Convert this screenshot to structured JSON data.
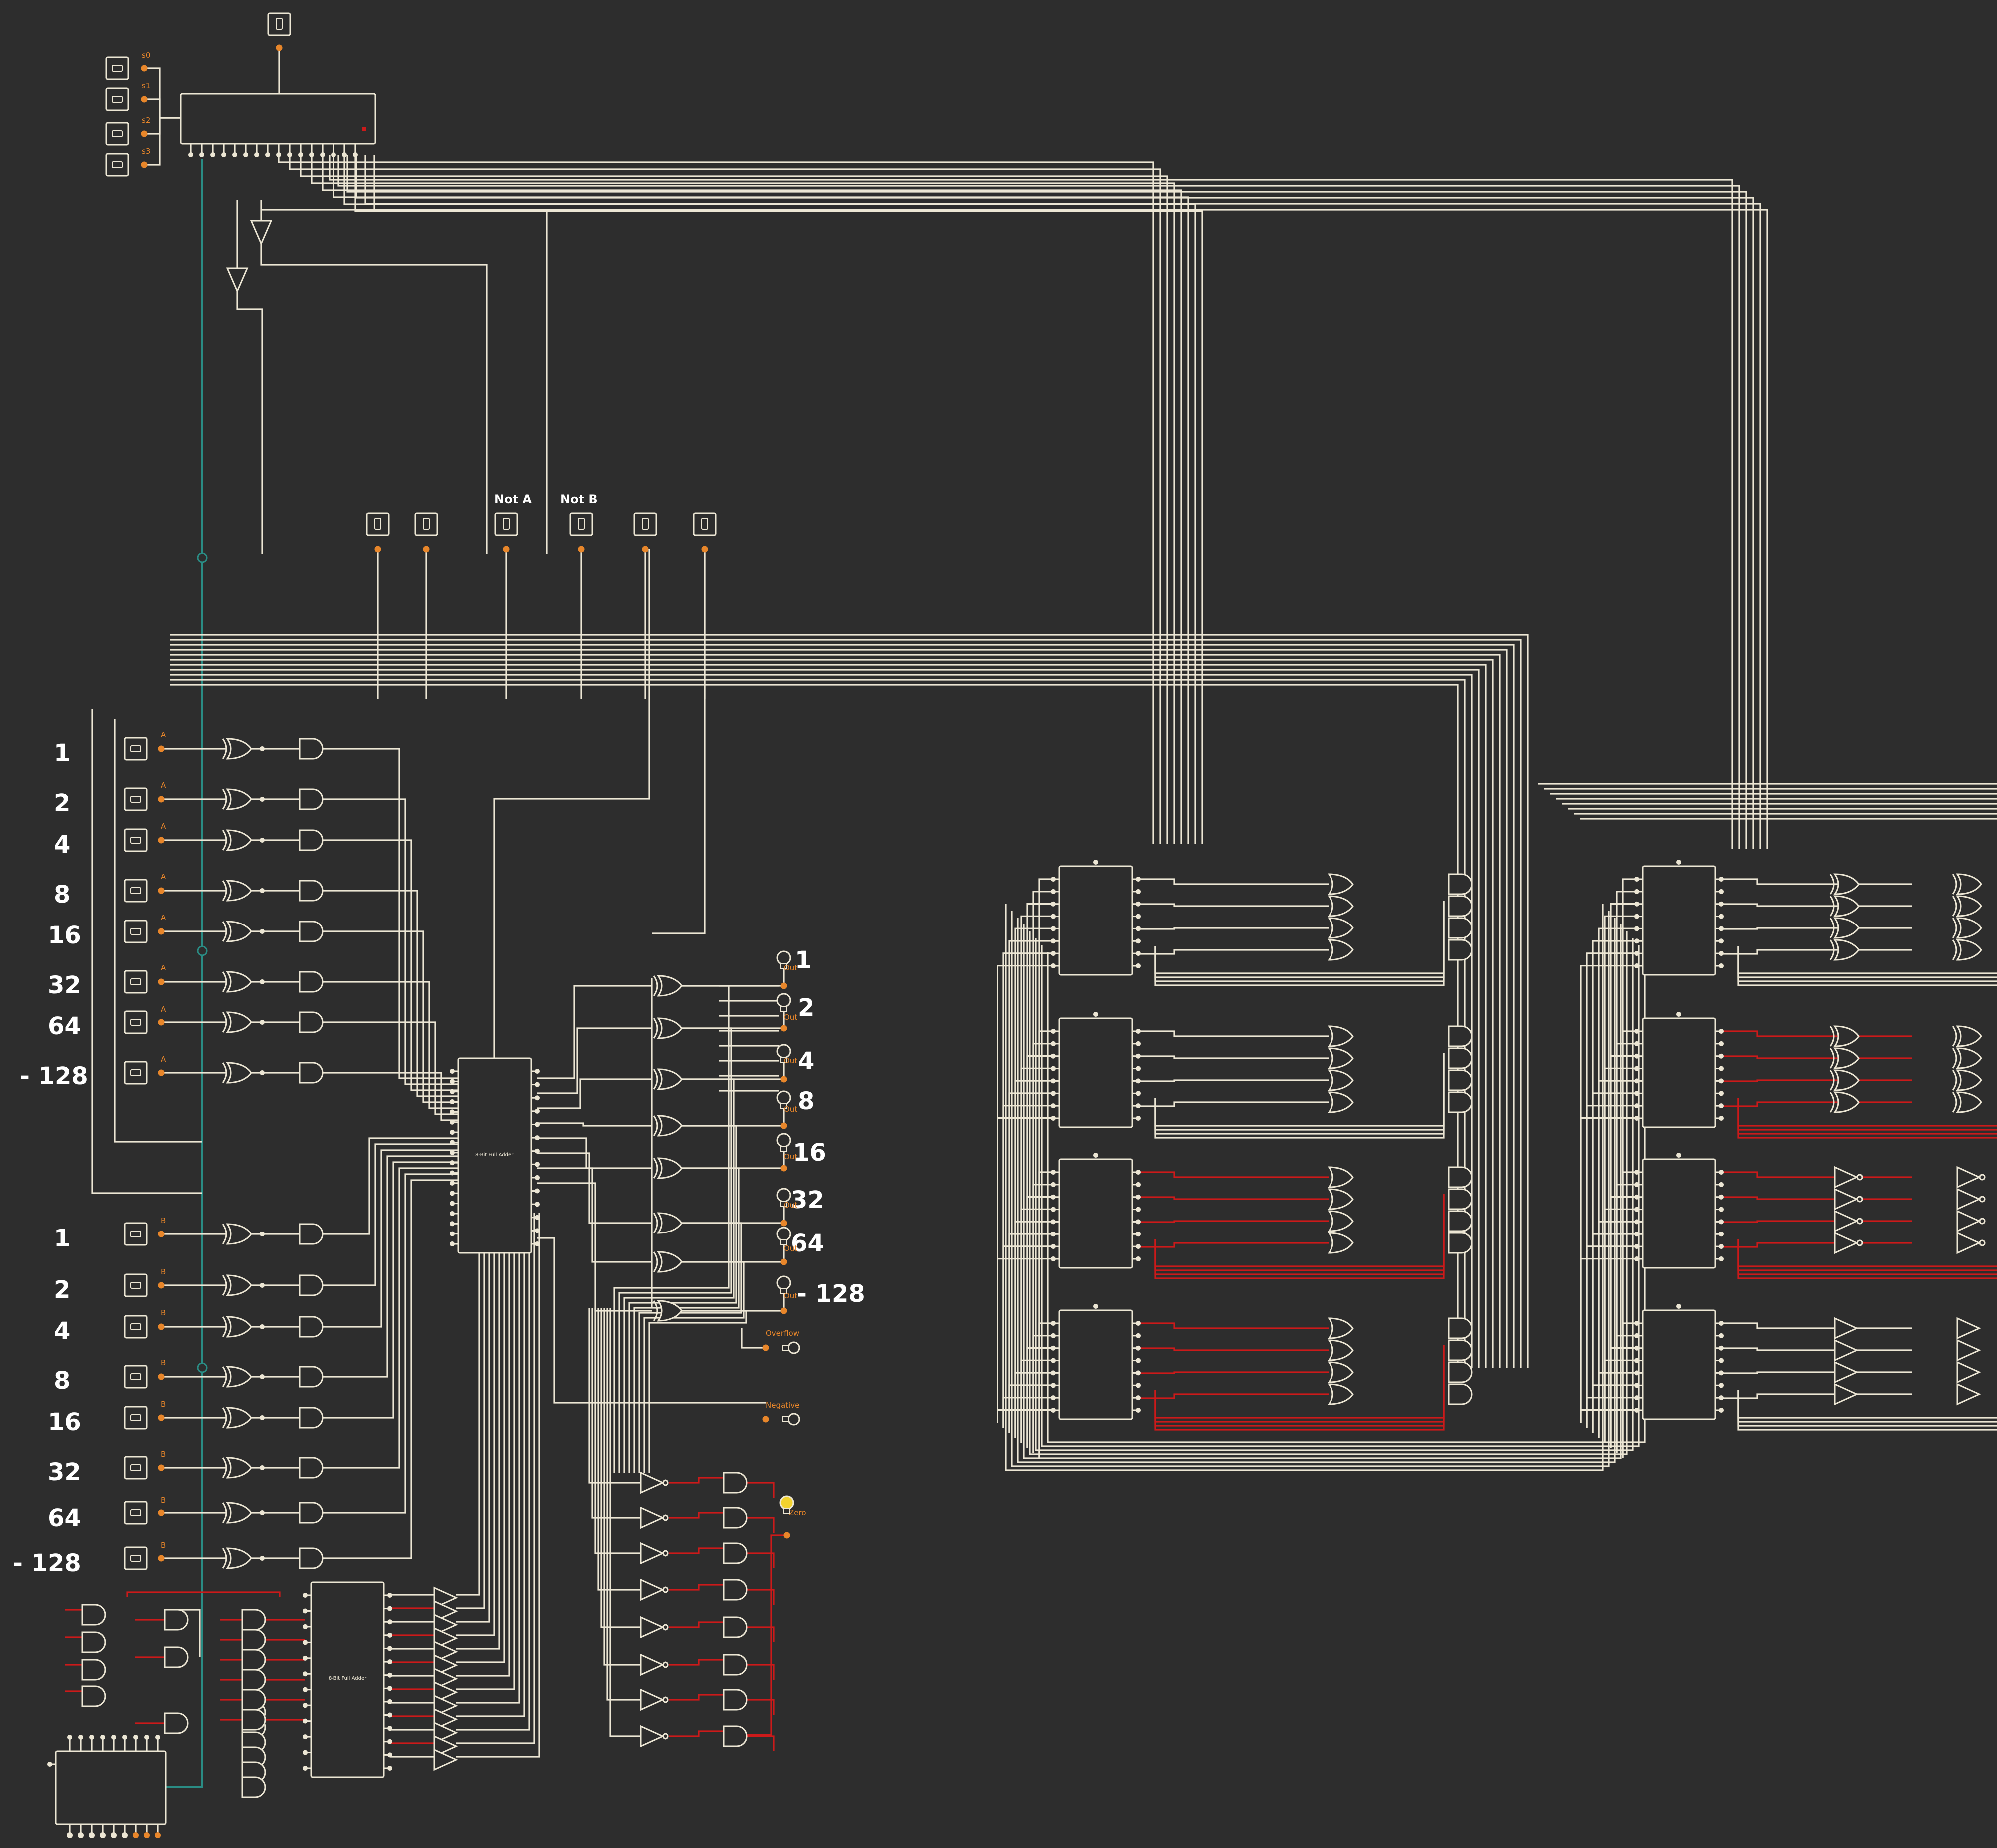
{
  "canvas": {
    "background": "#2d2d2d",
    "wire_color": "#ece6d4",
    "active_wire_color": "#cc1a1a",
    "bus_color": "#2a8c84",
    "pin_color": "#e8862a",
    "lamp_on_color": "#f2d22e"
  },
  "select_inputs": [
    "s0",
    "s1",
    "s2",
    "s3"
  ],
  "mode_switch_labels": [
    "Not A",
    "Not B"
  ],
  "input_a": {
    "pin_label": "A",
    "bit_labels": [
      "1",
      "2",
      "4",
      "8",
      "16",
      "32",
      "64",
      "- 128"
    ]
  },
  "input_b": {
    "pin_label": "B",
    "bit_labels": [
      "1",
      "2",
      "4",
      "8",
      "16",
      "32",
      "64",
      "- 128"
    ]
  },
  "adder_label": "8-Bit Full Adder",
  "output_pin_label": "Out",
  "output_labels": [
    "1",
    "2",
    "4",
    "8",
    "16",
    "32",
    "64",
    "- 128"
  ],
  "flags": [
    {
      "label": "Overflow",
      "lit": false
    },
    {
      "label": "Negative",
      "lit": false
    },
    {
      "label": "Zero",
      "lit": true
    }
  ],
  "icons": [
    "toggle-switch-icon",
    "light-bulb-icon",
    "xor-gate-icon",
    "and-gate-icon",
    "or-gate-icon",
    "not-gate-icon",
    "buffer-gate-icon",
    "multiplexer-icon",
    "decoder-icon"
  ]
}
